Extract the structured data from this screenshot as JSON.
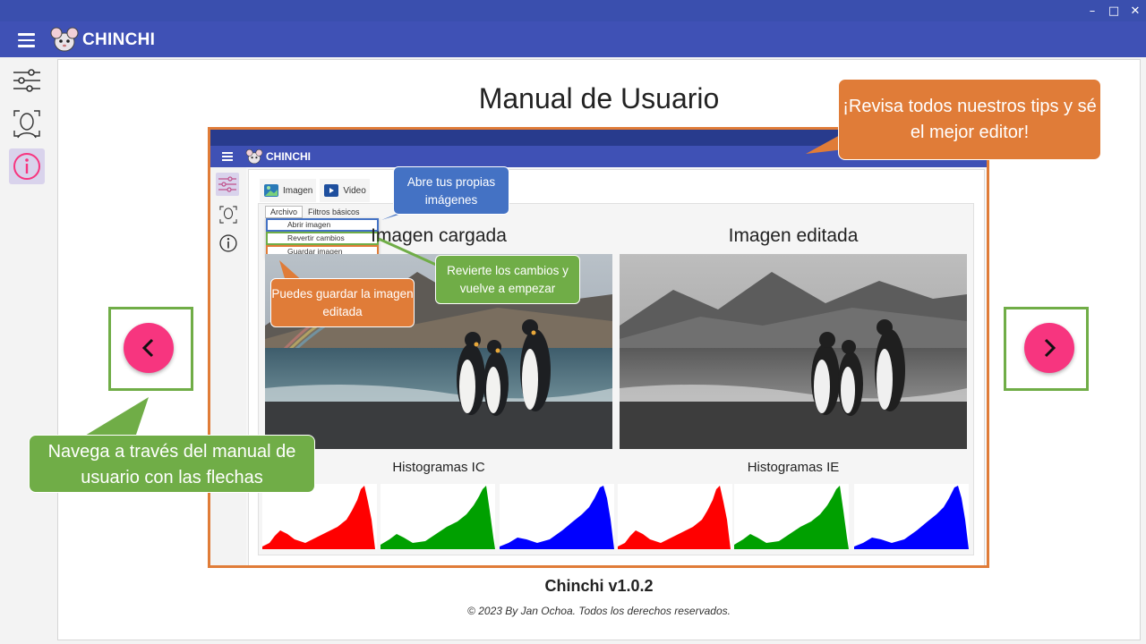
{
  "app": {
    "name": "CHINCHI",
    "window_controls": {
      "minimize": "–",
      "maximize": "□",
      "close": "✕"
    }
  },
  "sidebar": {
    "items": [
      {
        "name": "filters",
        "icon": "sliders-icon",
        "active": false
      },
      {
        "name": "face",
        "icon": "face-scan-icon",
        "active": false
      },
      {
        "name": "info",
        "icon": "info-icon",
        "active": true
      }
    ]
  },
  "manual": {
    "title": "Manual de Usuario",
    "version": "Chinchi v1.0.2",
    "copyright": "© 2023 By Jan Ochoa. Todos los derechos reservados."
  },
  "screenshot": {
    "app_name": "CHINCHI",
    "tabs": [
      {
        "label": "Imagen",
        "icon": "image-icon"
      },
      {
        "label": "Video",
        "icon": "video-icon"
      }
    ],
    "subtabs": [
      "Archivo",
      "Filtros básicos"
    ],
    "menu_items": [
      {
        "label": "Abrir imagen",
        "color": "#4472c4"
      },
      {
        "label": "Revertir cambios",
        "color": "#70ad47"
      },
      {
        "label": "Guardar imagen",
        "color": "#e07c38"
      }
    ],
    "loaded_title": "Imagen cargada",
    "edited_title": "Imagen editada",
    "hist_ic": "Histogramas IC",
    "hist_ie": "Histogramas IE"
  },
  "callouts": {
    "tips": "¡Revisa todos nuestros tips y sé el mejor editor!",
    "open": "Abre tus propias imágenes",
    "revert": "Revierte los cambios y vuelve a empezar",
    "save": "Puedes guardar la imagen editada",
    "nav": "Navega a través del manual de usuario con las flechas"
  },
  "colors": {
    "primary": "#3f51b5",
    "titlebar": "#3a4fae",
    "accent_pink": "#f7357f",
    "orange": "#e07c38",
    "green": "#70ad47",
    "blue": "#4472c4",
    "active_side": "#d9d3ec"
  },
  "navigation": {
    "prev_icon": "chevron-left-icon",
    "next_icon": "chevron-right-icon"
  }
}
